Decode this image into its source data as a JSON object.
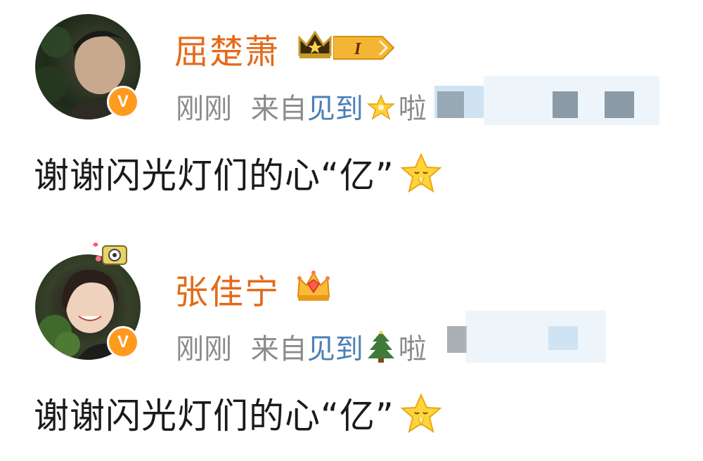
{
  "posts": [
    {
      "username": "屈楚萧",
      "time": "刚刚",
      "from_label": "来自",
      "device": "见到",
      "device_suffix": "啦",
      "content": "谢谢闪光灯们的心“亿”",
      "verified_badge_letter": "V",
      "level_badge_text": "I",
      "icons": [
        "crown-icon",
        "level-badge",
        "sparkle-star-emoji",
        "praying-star-emoji"
      ]
    },
    {
      "username": "张佳宁",
      "time": "刚刚",
      "from_label": "来自",
      "device": "见到",
      "device_suffix": "啦",
      "content": "谢谢闪光灯们的心“亿”",
      "verified_badge_letter": "V",
      "icons": [
        "crown-icon",
        "christmas-tree-emoji",
        "praying-star-emoji",
        "camera-decoration"
      ]
    }
  ],
  "colors": {
    "username": "#e36a1a",
    "meta": "#8b8b8b",
    "device_link": "#4b7fb5",
    "content": "#1a1a1a",
    "verified_badge": "#ff9a1f"
  }
}
